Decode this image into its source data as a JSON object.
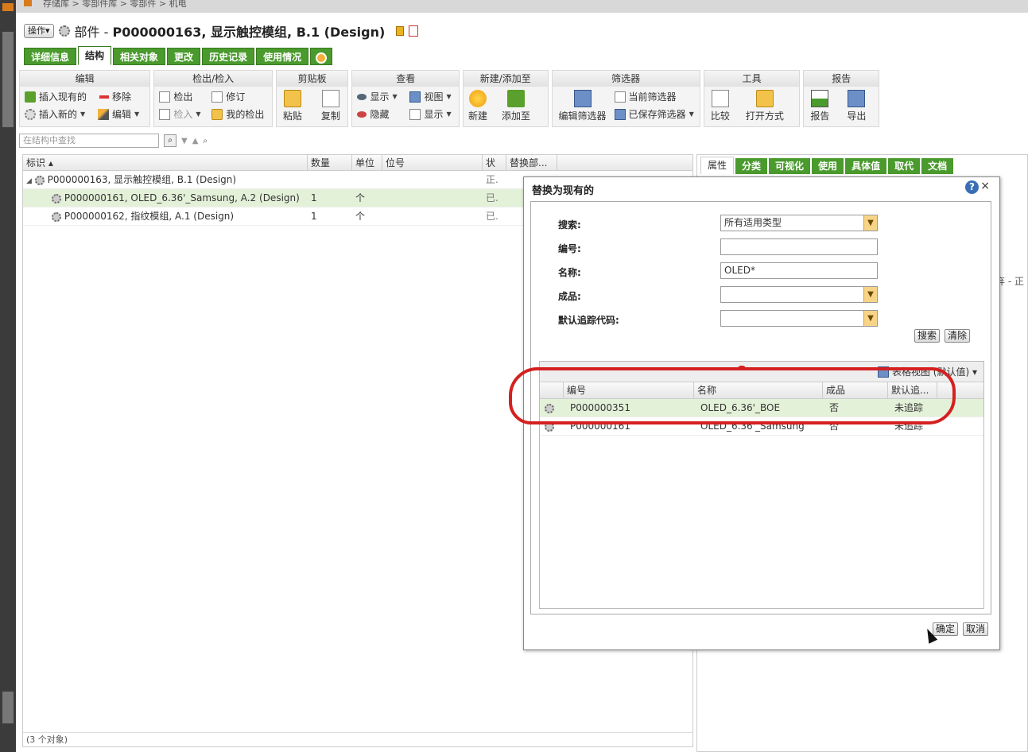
{
  "breadcrumb": {
    "text": "存储库 > 零部件库 > 零部件 > 机电"
  },
  "header": {
    "ops_label": "操作▾",
    "title_prefix": "部件 - ",
    "title_main": "P000000163, 显示触控模组, B.1 (Design)"
  },
  "tabs": [
    "详细信息",
    "结构",
    "相关对象",
    "更改",
    "历史记录",
    "使用情况"
  ],
  "toolbar": {
    "edit": {
      "title": "编辑",
      "insert_existing": "插入现有的",
      "remove": "移除",
      "insert_new": "插入新的",
      "edit": "编辑"
    },
    "checkout": {
      "title": "检出/检入",
      "checkout": "检出",
      "revise": "修订",
      "checkin": "检入",
      "my_checkout": "我的检出"
    },
    "clipboard": {
      "title": "剪贴板",
      "paste": "粘贴",
      "copy": "复制"
    },
    "view": {
      "title": "查看",
      "show": "显示",
      "view": "视图",
      "hide": "隐藏",
      "display": "显示"
    },
    "new": {
      "title": "新建/添加至",
      "new": "新建",
      "add_to": "添加至"
    },
    "filter": {
      "title": "筛选器",
      "edit_filter": "编辑筛选器",
      "current_filter": "当前筛选器",
      "saved_filter": "已保存筛选器"
    },
    "tools": {
      "title": "工具",
      "compare": "比较",
      "open_with": "打开方式"
    },
    "report": {
      "title": "报告",
      "report": "报告",
      "export": "导出"
    }
  },
  "search": {
    "placeholder": "在结构中查找"
  },
  "grid": {
    "columns": [
      "标识 ▴",
      "数量",
      "单位",
      "位号",
      "状",
      "替换部..."
    ],
    "rows": [
      {
        "id": "P000000163, 显示触控模组, B.1 (Design)",
        "qty": "",
        "unit": "",
        "pos": "",
        "status": "正."
      },
      {
        "id": "P000000161, OLED_6.36'_Samsung, A.2 (Design)",
        "qty": "1",
        "unit": "个",
        "pos": "",
        "status": "已."
      },
      {
        "id": "P000000162, 指纹模组, A.1 (Design)",
        "qty": "1",
        "unit": "个",
        "pos": "",
        "status": "已."
      }
    ],
    "footer": "(3 个对象)"
  },
  "right_tabs": [
    "属性",
    "分类",
    "可视化",
    "使用",
    "具体值",
    "取代",
    "文档"
  ],
  "right_text": "弃 - 正",
  "dialog": {
    "title": "替换为现有的",
    "form": {
      "search_label": "搜索:",
      "search_value": "所有适用类型",
      "number_label": "编号:",
      "number_value": "",
      "name_label": "名称:",
      "name_value": "OLED*",
      "product_label": "成品:",
      "product_value": "",
      "trace_label": "默认追踪代码:",
      "trace_value": "",
      "search_button": "搜索",
      "clear_button": "清除"
    },
    "results": {
      "view_label": "表格视图 (默认值) ▾",
      "columns": [
        "编号",
        "名称",
        "成品",
        "默认追..."
      ],
      "rows": [
        {
          "number": "P000000351",
          "name": "OLED_6.36'_BOE",
          "product": "否",
          "trace": "未追踪"
        },
        {
          "number": "P000000161",
          "name": "OLED_6.36'_Samsung",
          "product": "否",
          "trace": "未追踪"
        }
      ]
    },
    "ok_button": "确定",
    "cancel_button": "取消"
  },
  "colors": {
    "tab_green": "#4a9a2d",
    "selection": "#e4f1d9",
    "annotation": "#d42020"
  }
}
